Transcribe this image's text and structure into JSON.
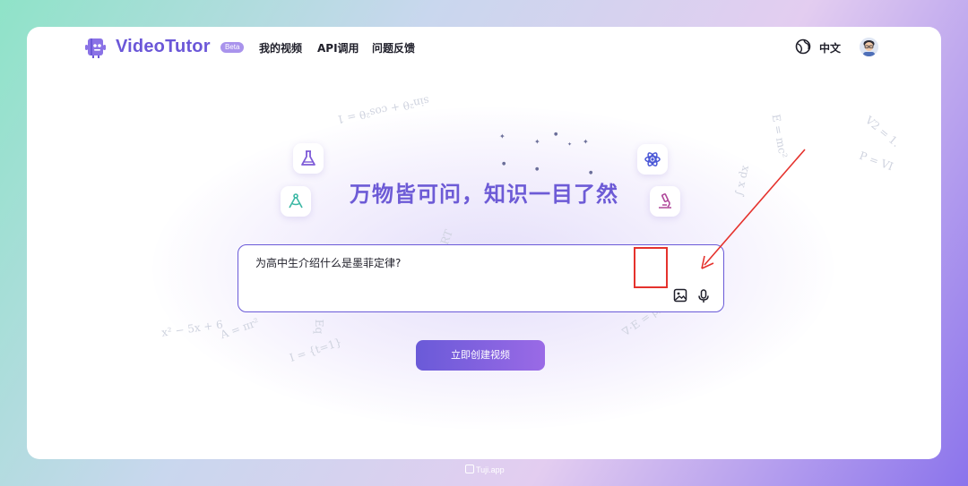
{
  "header": {
    "brand": "VideoTutor",
    "beta_badge": "Beta",
    "nav": [
      "我的视频",
      "API调用",
      "问题反馈"
    ],
    "language": "中文",
    "icons": {
      "logo": "book-robot-logo-icon",
      "language": "globe-icon",
      "avatar": "user-avatar"
    }
  },
  "hero": {
    "headline": "万物皆可问，知识一目了然",
    "tiles": [
      "flask-icon",
      "compass-icon",
      "atom-icon",
      "microscope-icon"
    ]
  },
  "prompt": {
    "value": "为高中生介绍什么是墨菲定律?",
    "icons": [
      "image-upload-icon",
      "microphone-icon"
    ]
  },
  "create_button": {
    "label": "立即创建视频"
  },
  "decor_formulas": [
    "sin²θ + cos²θ = 1",
    "x² − 5x + 6",
    "A = πr²",
    "∇·E = ρ/ε₀",
    "E = mc²",
    "∫ x dx",
    "V2 = 1.",
    "P = VI",
    "RT",
    "Eq",
    "I = {t=1}"
  ],
  "footer": {
    "watermark": "Tuji.app"
  },
  "colors": {
    "accent": "#6b57d8",
    "annotation": "#e5322d"
  }
}
